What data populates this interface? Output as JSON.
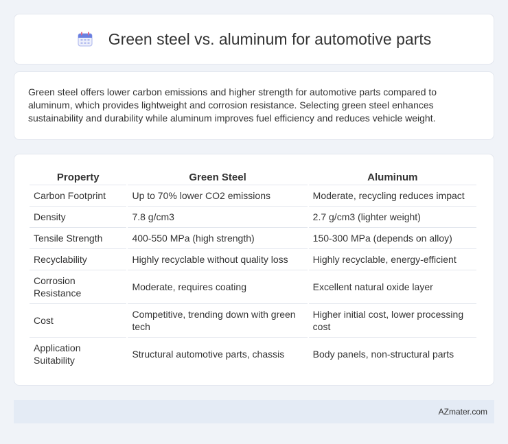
{
  "header": {
    "title": "Green steel vs. aluminum for automotive parts",
    "icon": "calendar-icon"
  },
  "summary": {
    "text": "Green steel offers lower carbon emissions and higher strength for automotive parts compared to aluminum, which provides lightweight and corrosion resistance. Selecting green steel enhances sustainability and durability while aluminum improves fuel efficiency and reduces vehicle weight."
  },
  "table": {
    "headers": [
      "Property",
      "Green Steel",
      "Aluminum"
    ],
    "rows": [
      [
        "Carbon Footprint",
        "Up to 70% lower CO2 emissions",
        "Moderate, recycling reduces impact"
      ],
      [
        "Density",
        "7.8 g/cm3",
        "2.7 g/cm3 (lighter weight)"
      ],
      [
        "Tensile Strength",
        "400-550 MPa (high strength)",
        "150-300 MPa (depends on alloy)"
      ],
      [
        "Recyclability",
        "Highly recyclable without quality loss",
        "Highly recyclable, energy-efficient"
      ],
      [
        "Corrosion Resistance",
        "Moderate, requires coating",
        "Excellent natural oxide layer"
      ],
      [
        "Cost",
        "Competitive, trending down with green tech",
        "Higher initial cost, lower processing cost"
      ],
      [
        "Application Suitability",
        "Structural automotive parts, chassis",
        "Body panels, non-structural parts"
      ]
    ]
  },
  "footer": {
    "text": "AZmater.com"
  },
  "colors": {
    "background": "#f0f3f8",
    "card": "#ffffff",
    "footer": "#e4ebf5",
    "icon_accent": "#6a7fe0"
  }
}
